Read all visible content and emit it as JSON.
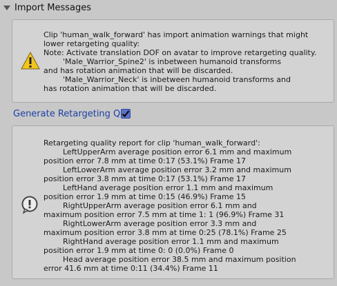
{
  "foldout": {
    "title": "Import Messages"
  },
  "warning": {
    "icon": "warning-icon",
    "text": "Clip 'human_walk_forward' has import animation warnings that might\nlower retargeting quality:\nNote: Activate translation DOF on avatar to improve retargeting quality.\n\t'Male_Warrior_Spine2' is inbetween humanoid transforms\nand has rotation animation that will be discarded.\n\t'Male_Warrior_Neck' is inbetween humanoid transforms and\nhas rotation animation that will be discarded."
  },
  "toggle": {
    "label": "Generate Retargeting Q",
    "checked": true
  },
  "report": {
    "icon": "info-icon",
    "text": "Retargeting quality report for clip 'human_walk_forward':\n\tLeftUpperArm average position error 6.1 mm and maximum\nposition error 7.8 mm at time 0:17 (53.1%) Frame 17\n\tLeftLowerArm average position error 3.2 mm and maximum\nposition error 3.8 mm at time 0:17 (53.1%) Frame 17\n\tLeftHand average position error 1.1 mm and maximum\nposition error 1.9 mm at time 0:15 (46.9%) Frame 15\n\tRightUpperArm average position error 6.1 mm and\nmaximum position error 7.5 mm at time 1: 1 (96.9%) Frame 31\n\tRightLowerArm average position error 3.3 mm and\nmaximum position error 3.8 mm at time 0:25 (78.1%) Frame 25\n\tRightHand average position error 1.1 mm and maximum\nposition error 1.9 mm at time 0: 0 (0.0%) Frame 0\n\tHead average position error 38.5 mm and maximum position\nerror 41.6 mm at time 0:11 (34.4%) Frame 11"
  }
}
